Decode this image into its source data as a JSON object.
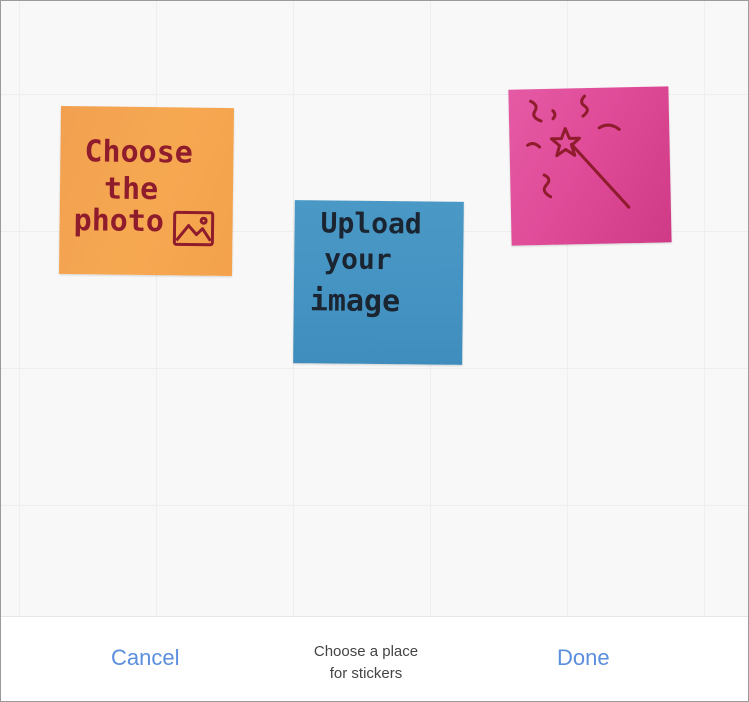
{
  "stickers": {
    "photo": {
      "line1": "Choose",
      "line2": "the",
      "line3": "photo",
      "icon": "image-icon",
      "color": "#f4a24c"
    },
    "upload": {
      "line1": "Upload",
      "line2": "your",
      "line3": "image",
      "color": "#4493c2"
    },
    "wand": {
      "icon": "magic-wand-icon",
      "color": "#df4a97"
    }
  },
  "footer": {
    "cancel_label": "Cancel",
    "done_label": "Done",
    "hint_line1": "Choose a place",
    "hint_line2": "for stickers",
    "accent_color": "#5b8fdd"
  }
}
